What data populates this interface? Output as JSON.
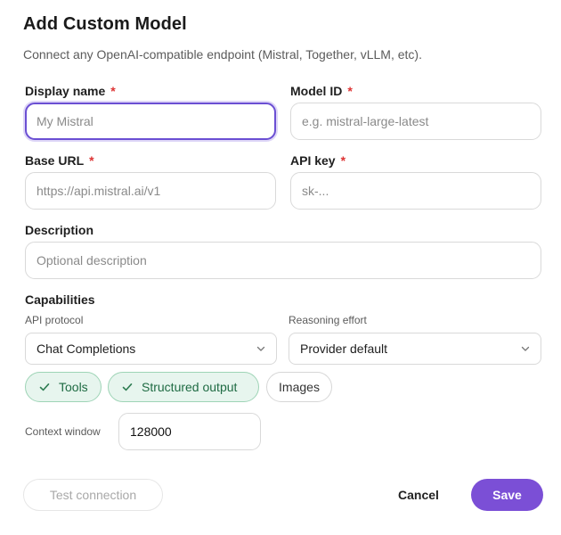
{
  "dialog": {
    "title": "Add Custom Model",
    "subtitle": "Connect any OpenAI-compatible endpoint (Mistral, Together, vLLM, etc)."
  },
  "fields": {
    "display_name": {
      "label": "Display name",
      "required_mark": "*",
      "value": "",
      "placeholder": "My Mistral"
    },
    "model_id": {
      "label": "Model ID",
      "required_mark": "*",
      "value": "",
      "placeholder": "e.g. mistral-large-latest"
    },
    "base_url": {
      "label": "Base URL",
      "required_mark": "*",
      "value": "",
      "placeholder": "https://api.mistral.ai/v1"
    },
    "api_key": {
      "label": "API key",
      "required_mark": "*",
      "value": "",
      "placeholder": "sk-..."
    },
    "description": {
      "label": "Description",
      "value": "",
      "placeholder": "Optional description"
    }
  },
  "capabilities": {
    "heading": "Capabilities",
    "api_protocol": {
      "label": "API protocol",
      "selected": "Chat Completions"
    },
    "reasoning_effort": {
      "label": "Reasoning effort",
      "selected": "Provider default"
    },
    "chips": {
      "tools": {
        "label": "Tools",
        "enabled": true
      },
      "structured_output": {
        "label": "Structured output",
        "enabled": true
      },
      "images": {
        "label": "Images",
        "enabled": false
      }
    },
    "context_window": {
      "label": "Context window",
      "value": "128000"
    }
  },
  "footer": {
    "test_label": "Test connection",
    "cancel_label": "Cancel",
    "save_label": "Save"
  },
  "colors": {
    "accent": "#7b4fd6",
    "focus_ring": "#6b4fd3",
    "chip_on_bg": "#e7f5ee",
    "chip_on_text": "#1f6b43",
    "required": "#dd3333"
  }
}
